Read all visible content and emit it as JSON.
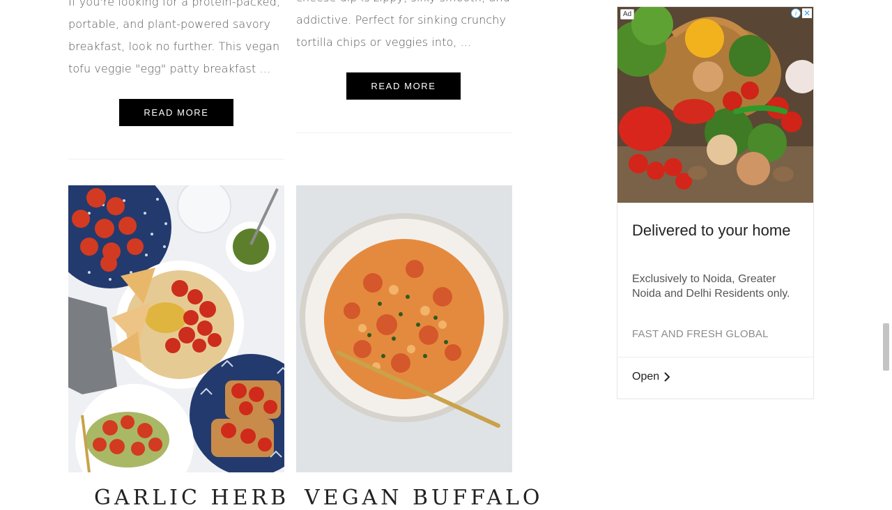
{
  "posts": [
    {
      "excerpt": "If you're looking for a protein-packed, portable, and plant-powered savory breakfast, look no further. This vegan tofu veggie \"egg\" patty breakfast ...",
      "read_more": "READ MORE"
    },
    {
      "excerpt": "cheese dip is zippy, silky smooth, and addictive. Perfect for sinking crunchy tortilla chips or veggies into, ...",
      "read_more": "READ MORE"
    }
  ],
  "cards": [
    {
      "title": "GARLIC HERB"
    },
    {
      "title": "VEGAN BUFFALO"
    }
  ],
  "ad": {
    "badge": "Ad",
    "choices_icon": "i",
    "close_icon": "✕",
    "headline": "Delivered to your home",
    "body": "Exclusively to Noida, Greater Noida and Delhi Residents only.",
    "advertiser": "FAST AND FRESH GLOBAL",
    "cta": "Open"
  },
  "colors": {
    "button_bg": "#000000",
    "button_text": "#ffffff"
  }
}
